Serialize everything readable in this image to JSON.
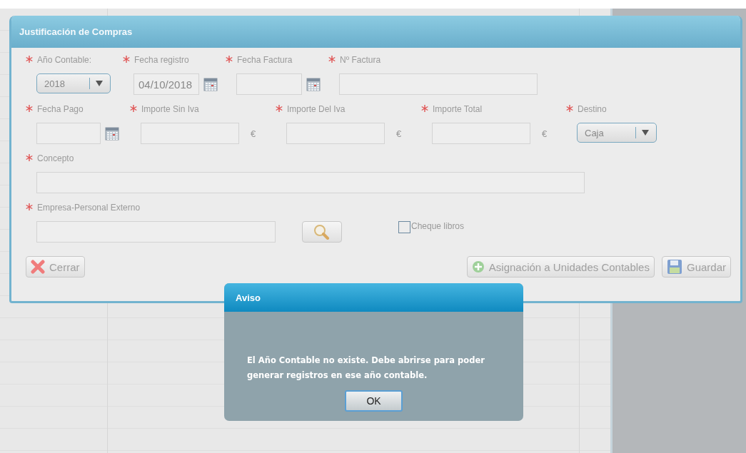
{
  "dialog": {
    "title": "Justificación de Compras",
    "rows": [
      {
        "fields": [
          {
            "label": "Año Contable:",
            "required": true,
            "kind": "select",
            "value": "2018"
          },
          {
            "label": "Fecha registro",
            "required": true,
            "kind": "date",
            "value": "04/10/2018"
          },
          {
            "label": "Fecha Factura",
            "required": true,
            "kind": "date"
          },
          {
            "label": "Nº Factura",
            "required": true,
            "kind": "text"
          }
        ]
      },
      {
        "fields": [
          {
            "label": "Fecha Pago",
            "required": true,
            "kind": "date"
          },
          {
            "label": "Importe Sin Iva",
            "required": true,
            "kind": "money",
            "currency": "€"
          },
          {
            "label": "Importe Del Iva",
            "required": true,
            "kind": "money",
            "currency": "€"
          },
          {
            "label": "Importe Total",
            "required": true,
            "kind": "money",
            "currency": "€"
          },
          {
            "label": "Destino",
            "required": true,
            "kind": "select",
            "value": "Caja"
          }
        ]
      },
      {
        "fields": [
          {
            "label": "Concepto",
            "required": true,
            "kind": "text"
          }
        ]
      },
      {
        "fields": [
          {
            "label": "Empresa-Personal Externo",
            "required": true,
            "kind": "lookup"
          }
        ]
      }
    ],
    "checkbox": {
      "label": "Cheque libros",
      "checked": false
    },
    "buttons": [
      {
        "label": "Cerrar",
        "kind": "close"
      },
      {
        "label": "Asignación a Unidades Contables",
        "kind": "add"
      },
      {
        "label": "Guardar",
        "kind": "save"
      }
    ]
  },
  "alert": {
    "title": "Aviso",
    "message": "El Año Contable no existe. Debe abrirse para poder generar registros en ese año contable.",
    "button": "OK"
  }
}
